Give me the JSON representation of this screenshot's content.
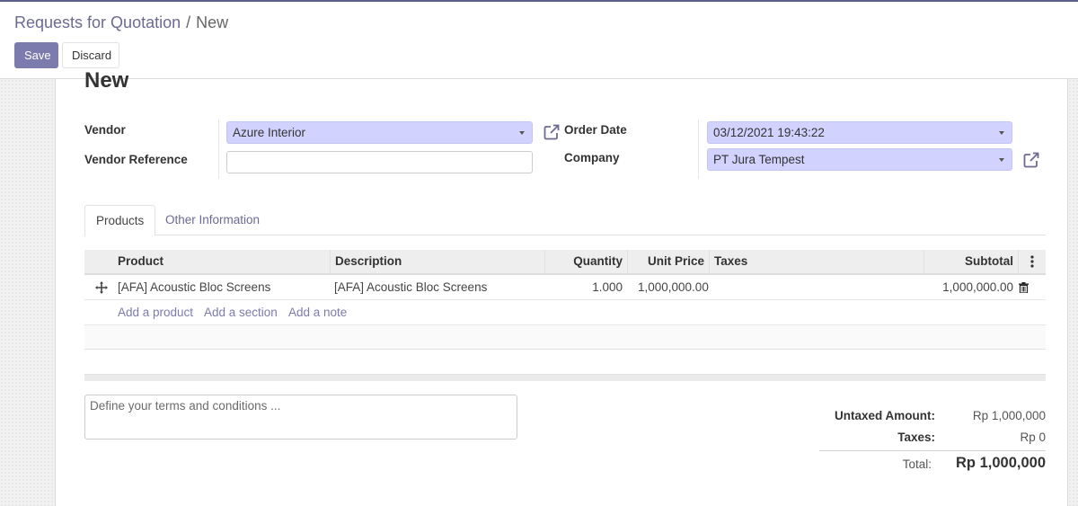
{
  "breadcrumb": {
    "parent": "Requests for Quotation",
    "separator": "/",
    "current": "New"
  },
  "toolbar": {
    "save_label": "Save",
    "discard_label": "Discard"
  },
  "form": {
    "title": "New",
    "vendor": {
      "label": "Vendor",
      "value": "Azure Interior",
      "icon": "external-link-icon"
    },
    "vendor_reference": {
      "label": "Vendor Reference",
      "value": ""
    },
    "order_date": {
      "label": "Order Date",
      "value": "03/12/2021 19:43:22"
    },
    "company": {
      "label": "Company",
      "value": "PT Jura Tempest",
      "icon": "external-link-icon"
    }
  },
  "tabs": [
    {
      "label": "Products",
      "active": true
    },
    {
      "label": "Other Information",
      "active": false
    }
  ],
  "order_lines": {
    "columns": [
      "Product",
      "Description",
      "Quantity",
      "Unit Price",
      "Taxes",
      "Subtotal"
    ],
    "rows": [
      {
        "product": "[AFA] Acoustic Bloc Screens",
        "description": "[AFA] Acoustic Bloc Screens",
        "quantity": "1.000",
        "unit_price": "1,000,000.00",
        "taxes": "",
        "subtotal": "1,000,000.00"
      }
    ],
    "add_links": [
      "Add a product",
      "Add a section",
      "Add a note"
    ]
  },
  "notes": {
    "placeholder": "Define your terms and conditions ...",
    "value": ""
  },
  "totals": {
    "untaxed_label": "Untaxed Amount:",
    "untaxed_value": "Rp 1,000,000",
    "taxes_label": "Taxes:",
    "taxes_value": "Rp 0",
    "total_label": "Total:",
    "total_value": "Rp 1,000,000"
  },
  "colors": {
    "brand": "#7c7bad",
    "required_field_bg": "#d2d2ff",
    "link": "#7c7bad"
  }
}
